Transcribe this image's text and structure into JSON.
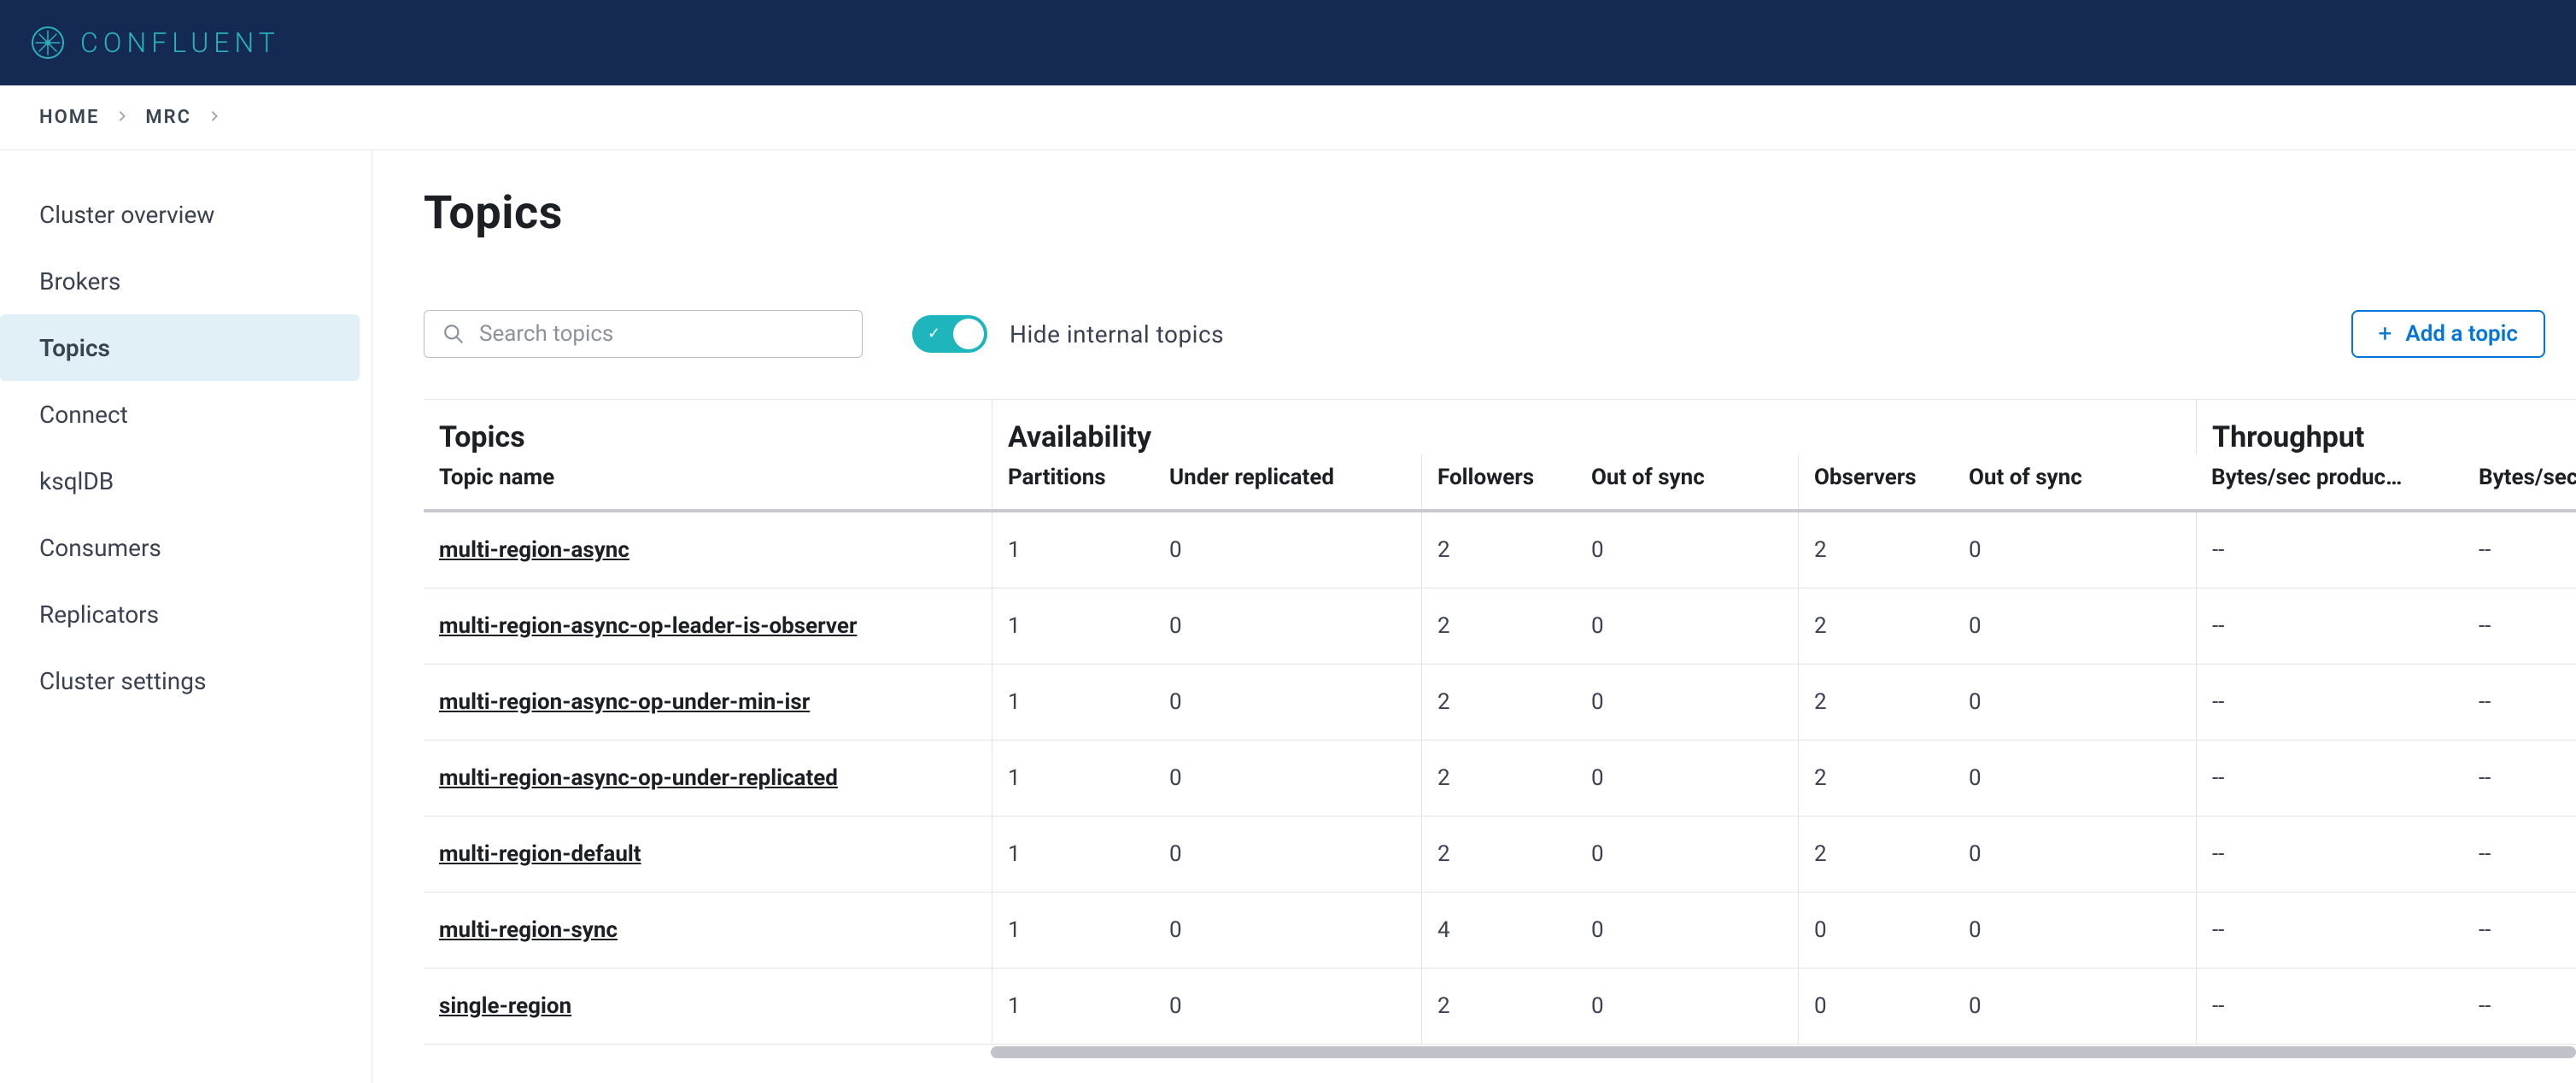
{
  "brand": "CONFLUENT",
  "breadcrumb": {
    "items": [
      "HOME",
      "MRC"
    ]
  },
  "sidebar": {
    "items": [
      {
        "label": "Cluster overview",
        "active": false
      },
      {
        "label": "Brokers",
        "active": false
      },
      {
        "label": "Topics",
        "active": true
      },
      {
        "label": "Connect",
        "active": false
      },
      {
        "label": "ksqlDB",
        "active": false
      },
      {
        "label": "Consumers",
        "active": false
      },
      {
        "label": "Replicators",
        "active": false
      },
      {
        "label": "Cluster settings",
        "active": false
      }
    ]
  },
  "page": {
    "title": "Topics",
    "search_placeholder": "Search topics",
    "hide_internal_label": "Hide internal topics",
    "hide_internal_on": true,
    "add_topic_label": "Add a topic"
  },
  "table": {
    "group_headers": {
      "topics": "Topics",
      "availability": "Availability",
      "throughput": "Throughput"
    },
    "columns": {
      "topic_name": "Topic name",
      "partitions": "Partitions",
      "under_replicated": "Under replicated",
      "followers": "Followers",
      "out_of_sync_1": "Out of sync",
      "observers": "Observers",
      "out_of_sync_2": "Out of sync",
      "bytes_produced": "Bytes/sec produc…",
      "bytes_consumed": "Bytes/sec consu"
    },
    "rows": [
      {
        "name": "multi-region-async",
        "partitions": "1",
        "under_replicated": "0",
        "followers": "2",
        "oos1": "0",
        "observers": "2",
        "oos2": "0",
        "bps_p": "--",
        "bps_c": "--"
      },
      {
        "name": "multi-region-async-op-leader-is-observer",
        "partitions": "1",
        "under_replicated": "0",
        "followers": "2",
        "oos1": "0",
        "observers": "2",
        "oos2": "0",
        "bps_p": "--",
        "bps_c": "--"
      },
      {
        "name": "multi-region-async-op-under-min-isr",
        "partitions": "1",
        "under_replicated": "0",
        "followers": "2",
        "oos1": "0",
        "observers": "2",
        "oos2": "0",
        "bps_p": "--",
        "bps_c": "--"
      },
      {
        "name": "multi-region-async-op-under-replicated",
        "partitions": "1",
        "under_replicated": "0",
        "followers": "2",
        "oos1": "0",
        "observers": "2",
        "oos2": "0",
        "bps_p": "--",
        "bps_c": "--"
      },
      {
        "name": "multi-region-default",
        "partitions": "1",
        "under_replicated": "0",
        "followers": "2",
        "oos1": "0",
        "observers": "2",
        "oos2": "0",
        "bps_p": "--",
        "bps_c": "--"
      },
      {
        "name": "multi-region-sync",
        "partitions": "1",
        "under_replicated": "0",
        "followers": "4",
        "oos1": "0",
        "observers": "0",
        "oos2": "0",
        "bps_p": "--",
        "bps_c": "--"
      },
      {
        "name": "single-region",
        "partitions": "1",
        "under_replicated": "0",
        "followers": "2",
        "oos1": "0",
        "observers": "0",
        "oos2": "0",
        "bps_p": "--",
        "bps_c": "--"
      }
    ]
  }
}
